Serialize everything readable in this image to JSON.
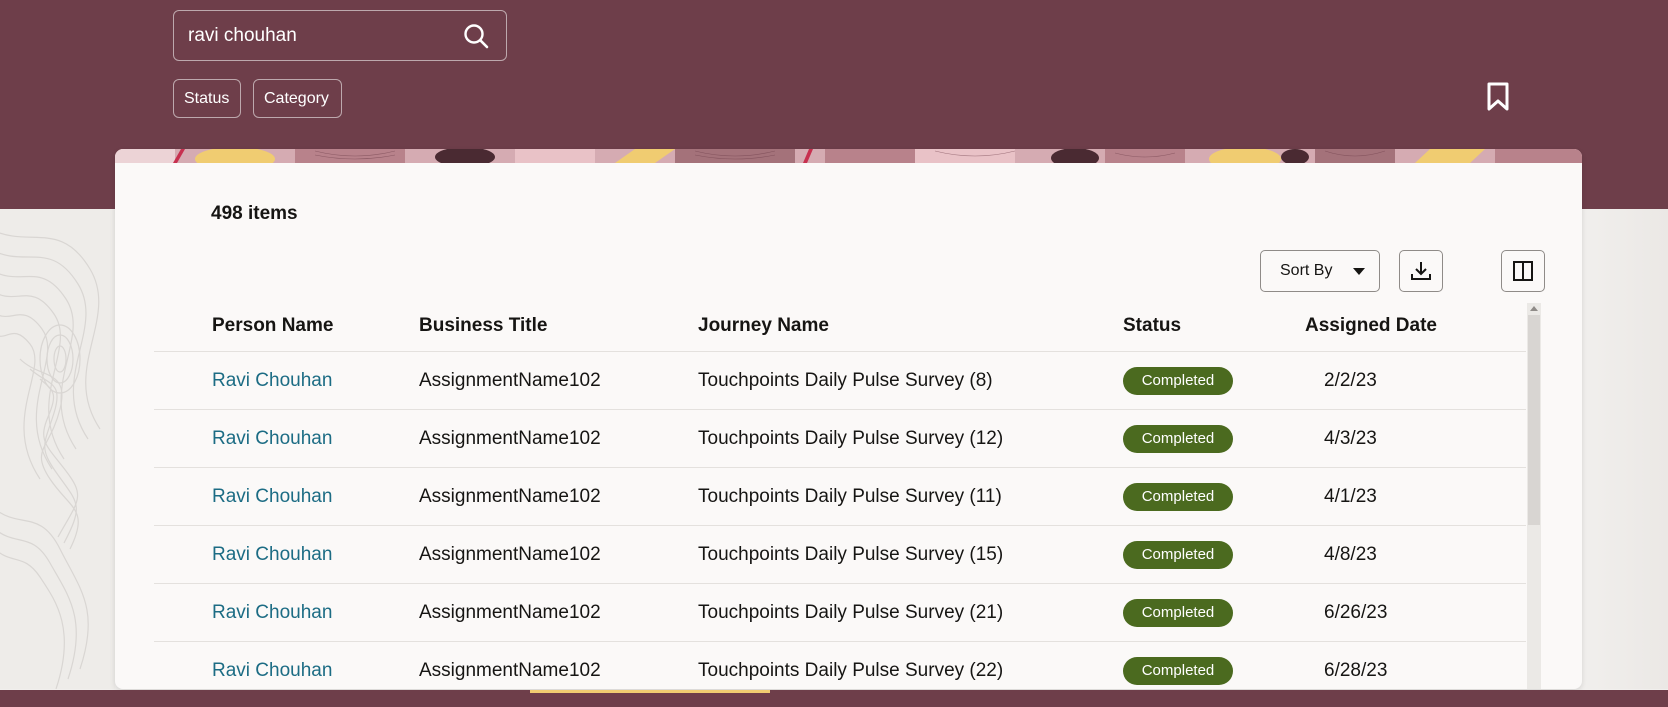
{
  "search": {
    "value": "ravi chouhan",
    "icon": "search-icon"
  },
  "filters": {
    "status_label": "Status",
    "category_label": "Category"
  },
  "header": {
    "bookmark_icon": "bookmark-icon"
  },
  "results": {
    "count_label": "498 items",
    "sort_label": "Sort By",
    "download_icon": "download-icon",
    "columns_icon": "column-layout-icon"
  },
  "table": {
    "columns": [
      "Person Name",
      "Business Title",
      "Journey Name",
      "Status",
      "Assigned Date"
    ],
    "rows": [
      {
        "person": "Ravi Chouhan",
        "title": "AssignmentName102",
        "journey": "Touchpoints Daily Pulse Survey (8)",
        "status": "Completed",
        "date": "2/2/23"
      },
      {
        "person": "Ravi Chouhan",
        "title": "AssignmentName102",
        "journey": "Touchpoints Daily Pulse Survey (12)",
        "status": "Completed",
        "date": "4/3/23"
      },
      {
        "person": "Ravi Chouhan",
        "title": "AssignmentName102",
        "journey": "Touchpoints Daily Pulse Survey (11)",
        "status": "Completed",
        "date": "4/1/23"
      },
      {
        "person": "Ravi Chouhan",
        "title": "AssignmentName102",
        "journey": "Touchpoints Daily Pulse Survey (15)",
        "status": "Completed",
        "date": "4/8/23"
      },
      {
        "person": "Ravi Chouhan",
        "title": "AssignmentName102",
        "journey": "Touchpoints Daily Pulse Survey (21)",
        "status": "Completed",
        "date": "6/26/23"
      },
      {
        "person": "Ravi Chouhan",
        "title": "AssignmentName102",
        "journey": "Touchpoints Daily Pulse Survey (22)",
        "status": "Completed",
        "date": "6/28/23"
      }
    ]
  },
  "colors": {
    "header_background": "#6e3e4a",
    "link": "#1c6c84",
    "status_completed": "#4b6a1f",
    "accent_yellow": "#f0cc71"
  }
}
